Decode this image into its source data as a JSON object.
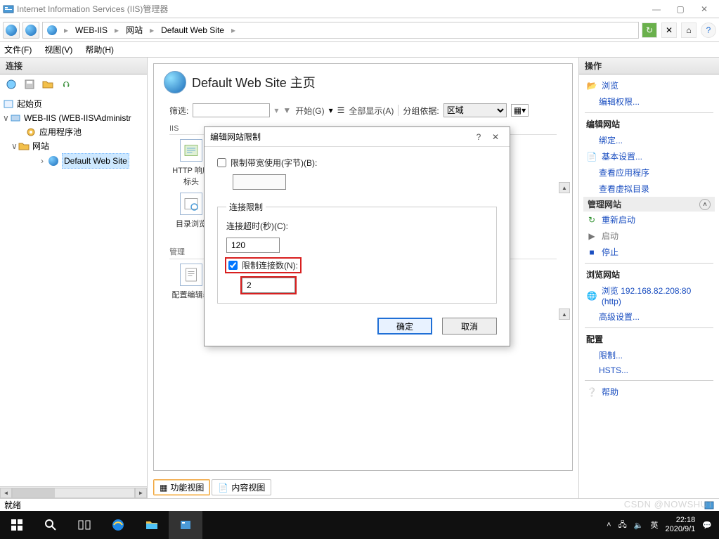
{
  "window": {
    "title": "Internet Information Services (IIS)管理器",
    "minimize": "—",
    "maximize": "▢",
    "close": "✕"
  },
  "breadcrumb": {
    "items": [
      "WEB-IIS",
      "网站",
      "Default Web Site"
    ],
    "sep": "▸"
  },
  "menubar": {
    "file": "文件(F)",
    "view": "视图(V)",
    "help": "帮助(H)"
  },
  "left": {
    "header": "连接",
    "tree": {
      "start": "起始页",
      "server": "WEB-IIS (WEB-IIS\\Administr",
      "apppools": "应用程序池",
      "sites": "网站",
      "defaultSite": "Default Web Site"
    }
  },
  "center": {
    "title": "Default Web Site 主页",
    "filter": {
      "label": "筛选:",
      "startBtn": "开始(G)",
      "showAll": "全部显示(A)",
      "groupByLabel": "分组依据:",
      "groupByValue": "区域"
    },
    "sections": {
      "iis": "IIS",
      "management": "管理"
    },
    "features": {
      "httpHeaders": "HTTP 响应标头",
      "dirBrowse": "目录浏览",
      "configEditor": "配置编辑器"
    },
    "tabs": {
      "features": "功能视图",
      "content": "内容视图"
    }
  },
  "right": {
    "header": "操作",
    "explore": "浏览",
    "editPerm": "编辑权限...",
    "editSite": "编辑网站",
    "bindings": "绑定...",
    "basicSettings": "基本设置...",
    "viewApps": "查看应用程序",
    "viewVdirs": "查看虚拟目录",
    "manageSite": "管理网站",
    "restart": "重新启动",
    "start": "启动",
    "stop": "停止",
    "browseSite": "浏览网站",
    "browseBinding": "浏览 192.168.82.208:80 (http)",
    "advanced": "高级设置...",
    "configure": "配置",
    "limits": "限制...",
    "hsts": "HSTS...",
    "help": "帮助"
  },
  "dialog": {
    "title": "编辑网站限制",
    "helpBtn": "?",
    "closeBtn": "✕",
    "bandwidthChk": "限制带宽使用(字节)(B):",
    "bandwidthValue": "",
    "fieldset": "连接限制",
    "timeoutLabel": "连接超时(秒)(C):",
    "timeoutValue": "120",
    "limitConnChk": "限制连接数(N):",
    "limitConnValue": "2",
    "ok": "确定",
    "cancel": "取消"
  },
  "status": {
    "ready": "就绪"
  },
  "taskbar": {
    "ime": "英",
    "time": "22:18",
    "date": "2020/9/1"
  },
  "watermark": "CSDN @NOWSHUT"
}
